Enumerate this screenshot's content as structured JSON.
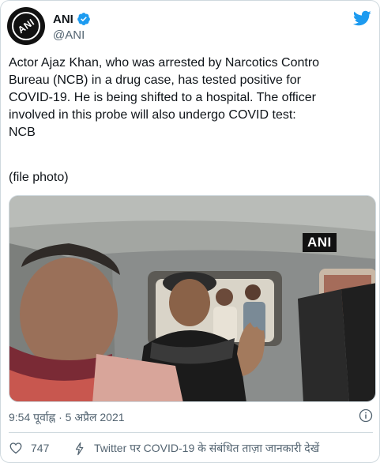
{
  "account": {
    "display_name": "ANI",
    "handle": "@ANI",
    "avatar_text": "ANI"
  },
  "tweet": {
    "text": "Actor Ajaz Khan, who was arrested by Narcotics Contro\nBureau (NCB) in a drug case, has tested positive for\nCOVID-19. He is being shifted to a hospital. The officer\ninvolved in this probe will also undergo COVID test:\nNCB",
    "file_note": "(file photo)"
  },
  "media": {
    "watermark": "ANI",
    "description_icon": "photo"
  },
  "meta": {
    "timestamp": "9:54 पूर्वाह्न · 5 अप्रैल 2021"
  },
  "actions": {
    "like_count": "747",
    "covid_info_label": "Twitter पर COVID-19 के संबंधित ताज़ा जानकारी देखें"
  },
  "colors": {
    "twitter_blue": "#1d9bf0",
    "text_primary": "#0f1419",
    "text_secondary": "#536471",
    "border": "#cfd9de"
  },
  "icons": [
    "verified-badge-icon",
    "twitter-bird-icon",
    "info-icon",
    "heart-icon",
    "lightning-bolt-icon"
  ]
}
